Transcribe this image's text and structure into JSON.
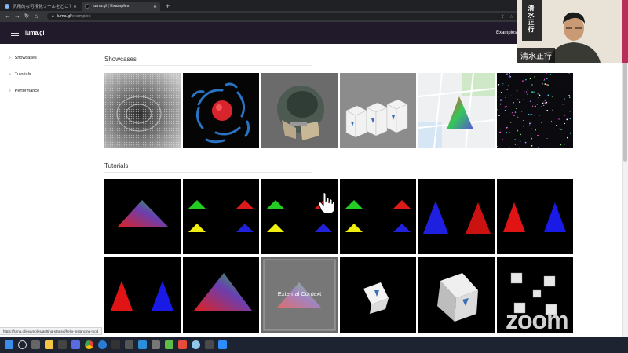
{
  "browser": {
    "tabs": [
      {
        "label": "汎用的な可視化ツールをどこで作れる?",
        "active": false
      },
      {
        "label": "luma.gl | Examples",
        "active": true
      }
    ],
    "address": {
      "host": "luma.gl",
      "path": "/examples"
    }
  },
  "site": {
    "brand": "luma.gl",
    "nav_examples": "Examples"
  },
  "sidebar": {
    "items": [
      {
        "label": "Showcases"
      },
      {
        "label": "Tutorials"
      },
      {
        "label": "Performance"
      }
    ]
  },
  "main": {
    "showcases_title": "Showcases",
    "tutorials_title": "Tutorials",
    "external_context_label": "External Context"
  },
  "status": {
    "url": "https://luma.gl/examples/getting-started/hello-instancing-mod"
  },
  "video": {
    "vertical_text": "清水正行",
    "name": "清水正行"
  },
  "watermark": "zoom",
  "colors": {
    "header_bg": "#201a2a",
    "video_accent": "#b82d5a"
  }
}
